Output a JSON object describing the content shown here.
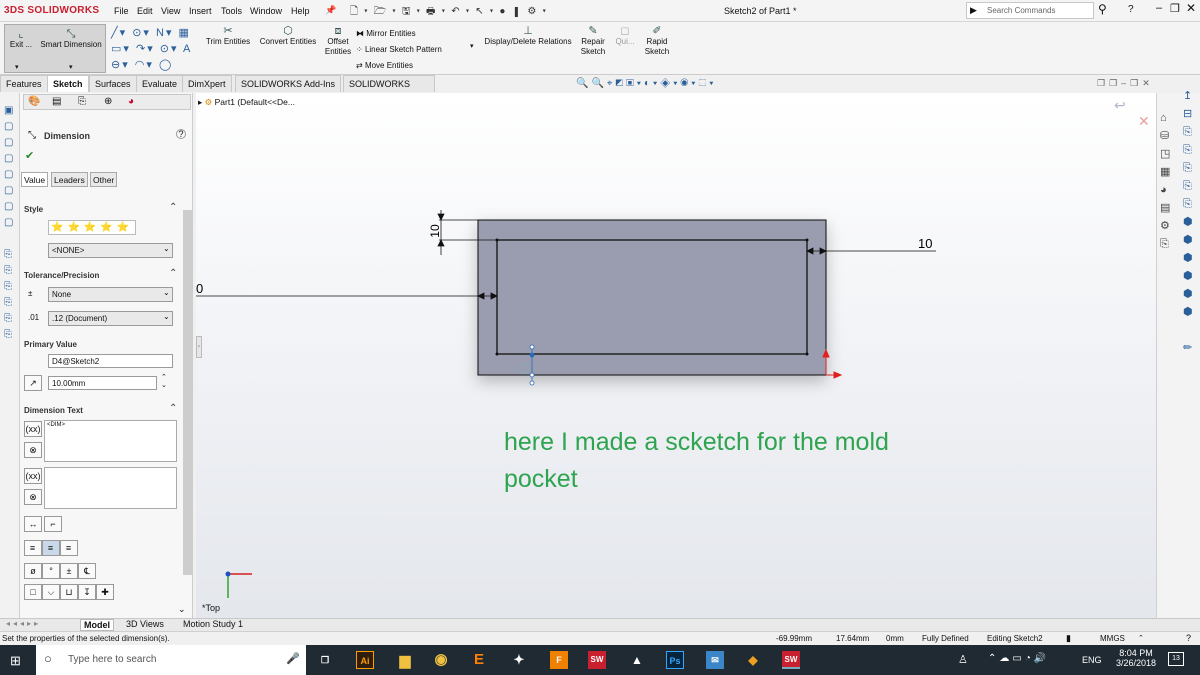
{
  "app": {
    "logo_text": "3DS SOLIDWORKS",
    "doc_title": "Sketch2 of Part1 *"
  },
  "menu": [
    "File",
    "Edit",
    "View",
    "Insert",
    "Tools",
    "Window",
    "Help"
  ],
  "search": {
    "placeholder": "Search Commands"
  },
  "ribbon": {
    "exit_label": "Exit ...",
    "smart_dim_label": "Smart Dimension",
    "trim_label": "Trim Entities",
    "convert_label": "Convert Entities",
    "offset_label": "Offset Entities",
    "mirror_label": "Mirror Entities",
    "linear_pattern_label": "Linear Sketch Pattern",
    "move_label": "Move Entities",
    "display_relations_label": "Display/Delete Relations",
    "repair_label": "Repair Sketch",
    "quick_label": "Qui...",
    "rapid_label": "Rapid Sketch"
  },
  "tabs": [
    "Features",
    "Sketch",
    "Surfaces",
    "Evaluate",
    "DimXpert",
    "SOLIDWORKS Add-Ins",
    "SOLIDWORKS MBD"
  ],
  "active_tab": "Sketch",
  "tree": {
    "part_label": "Part1  (Default<<De..."
  },
  "propmgr": {
    "title": "Dimension",
    "subtabs": [
      "Value",
      "Leaders",
      "Other"
    ],
    "style_header": "Style",
    "style_select": "<NONE>",
    "tolerance_header": "Tolerance/Precision",
    "tolerance_select": "None",
    "precision_select": ".12 (Document)",
    "primary_header": "Primary Value",
    "primary_name": "D4@Sketch2",
    "primary_value": "10.00mm",
    "dimtext_header": "Dimension Text",
    "dimtext_value": "<DIM>"
  },
  "canvas": {
    "dim_vertical": "10",
    "dim_right": "10",
    "dim_left": "0",
    "triad_label": "*Top",
    "annotation_line1": "here I made a scketch for the mold",
    "annotation_line2": "pocket"
  },
  "bottom_tabs": [
    "Model",
    "3D Views",
    "Motion Study 1"
  ],
  "status": {
    "message": "Set the properties of the selected dimension(s).",
    "x": "-69.99mm",
    "y": "17.64mm",
    "z": "0mm",
    "state": "Fully Defined",
    "editing": "Editing Sketch2",
    "units": "MMGS"
  },
  "taskbar": {
    "search_placeholder": "Type here to search",
    "lang": "ENG",
    "time": "8:04 PM",
    "date": "3/26/2018",
    "notif_count": "13"
  },
  "colors": {
    "annotation": "#2ea44f",
    "sketch_fill": "#9a9caf",
    "accent_red": "#c8202f"
  }
}
